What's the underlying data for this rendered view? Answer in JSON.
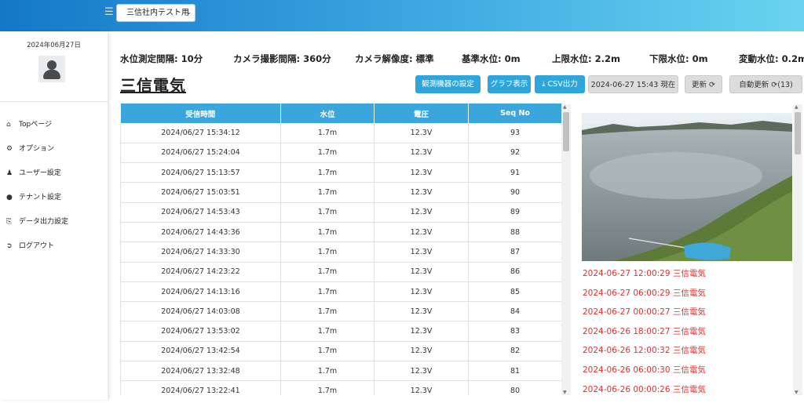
{
  "header": {
    "tenant_select_value": "三信社内テスト用",
    "menu_icon": "hamburger-icon"
  },
  "sidebar": {
    "date": "2024年06月27日",
    "avatar_icon": "user-icon",
    "items": [
      {
        "label": "Topページ",
        "icon": "home-icon"
      },
      {
        "label": "オプション",
        "icon": "gear-icon"
      },
      {
        "label": "ユーザー設定",
        "icon": "users-icon"
      },
      {
        "label": "テナント設定",
        "icon": "map-pin-icon"
      },
      {
        "label": "データ出力設定",
        "icon": "file-export-icon"
      },
      {
        "label": "ログアウト",
        "icon": "logout-icon"
      }
    ]
  },
  "params": {
    "interval": "水位測定間隔: 10分",
    "camera_interval": "カメラ撮影間隔: 360分",
    "resolution": "カメラ解像度: 標準",
    "base_level": "基準水位: 0m",
    "upper_limit": "上限水位: 2.2m",
    "lower_limit": "下限水位: 0m",
    "change_level": "変動水位: 0.2m"
  },
  "site_title": "三信電気",
  "toolbar": {
    "device_settings": "観測機器の設定",
    "graph": "グラフ表示",
    "csv": "CSV出力",
    "current_time": "2024-06-27 15:43 現在",
    "refresh": "更新",
    "auto_refresh": "自動更新",
    "auto_refresh_count": "(13)"
  },
  "table": {
    "columns": [
      "受信時間",
      "水位",
      "電圧",
      "Seq No"
    ],
    "rows": [
      [
        "2024/06/27 15:34:12",
        "1.7m",
        "12.3V",
        "93"
      ],
      [
        "2024/06/27 15:24:04",
        "1.7m",
        "12.3V",
        "92"
      ],
      [
        "2024/06/27 15:13:57",
        "1.7m",
        "12.3V",
        "91"
      ],
      [
        "2024/06/27 15:03:51",
        "1.7m",
        "12.3V",
        "90"
      ],
      [
        "2024/06/27 14:53:43",
        "1.7m",
        "12.3V",
        "89"
      ],
      [
        "2024/06/27 14:43:36",
        "1.7m",
        "12.3V",
        "88"
      ],
      [
        "2024/06/27 14:33:30",
        "1.7m",
        "12.3V",
        "87"
      ],
      [
        "2024/06/27 14:23:22",
        "1.7m",
        "12.3V",
        "86"
      ],
      [
        "2024/06/27 14:13:16",
        "1.7m",
        "12.3V",
        "85"
      ],
      [
        "2024/06/27 14:03:08",
        "1.7m",
        "12.3V",
        "84"
      ],
      [
        "2024/06/27 13:53:02",
        "1.7m",
        "12.3V",
        "83"
      ],
      [
        "2024/06/27 13:42:54",
        "1.7m",
        "12.3V",
        "82"
      ],
      [
        "2024/06/27 13:32:48",
        "1.7m",
        "12.3V",
        "81"
      ],
      [
        "2024/06/27 13:22:41",
        "1.7m",
        "12.3V",
        "80"
      ]
    ]
  },
  "camera_log": [
    "2024-06-27 12:00:29 三信電気",
    "2024-06-27 06:00:29 三信電気",
    "2024-06-27 00:00:27 三信電気",
    "2024-06-26 18:00:27 三信電気",
    "2024-06-26 12:00:32 三信電気",
    "2024-06-26 06:00:30 三信電気",
    "2024-06-26 00:00:26 三信電気"
  ],
  "colors": {
    "accent": "#2ea6dc",
    "log_text": "#e03030"
  }
}
